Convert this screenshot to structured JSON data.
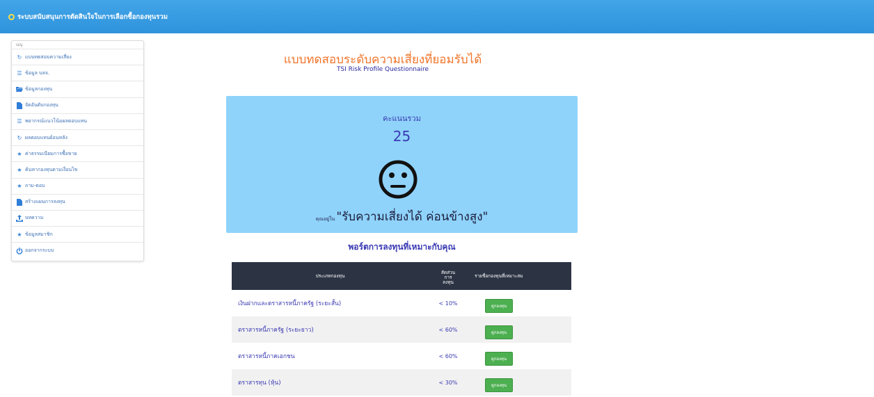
{
  "header": {
    "title": "ระบบสนับสนุนการตัดสินใจในการเลือกซื้อกองทุนรวม",
    "bg_color": "#3a9fe3"
  },
  "sidebar": {
    "caption": "เมนู",
    "items": [
      {
        "label": "แบบทดสอบความเสี่ยง",
        "icon": "refresh-icon"
      },
      {
        "label": "ข้อมูล บลจ.",
        "icon": "list-icon"
      },
      {
        "label": "ข้อมูลกองทุน",
        "icon": "folder-open-icon"
      },
      {
        "label": "จัดอันดับกองทุน",
        "icon": "file-icon"
      },
      {
        "label": "พยากรณ์แนวโน้มผลตอบแทน",
        "icon": "list-icon"
      },
      {
        "label": "ผลตอบแทนย้อนหลัง",
        "icon": "refresh-icon"
      },
      {
        "label": "ค่าธรรมเนียมการซื้อขาย",
        "icon": "star-icon"
      },
      {
        "label": "ค้นหากองทุนตามเงื่อนไข",
        "icon": "star-icon"
      },
      {
        "label": "ถาม-ตอบ",
        "icon": "star-icon"
      },
      {
        "label": "สร้างแผนการลงทุน",
        "icon": "file-icon"
      },
      {
        "label": "บทความ",
        "icon": "upload-icon"
      },
      {
        "label": "ข้อมูลสมาชิก",
        "icon": "star-icon"
      },
      {
        "label": "ออกจากระบบ",
        "icon": "power-icon"
      }
    ]
  },
  "main": {
    "title": "แบบทดสอบระดับความเสี่ยงที่ยอมรับได้",
    "subtitle": "TSI Risk Profile Questionnaire",
    "score_label": "คะแนนรวม",
    "score_value": "25",
    "face_icon": "neutral-face-icon",
    "result_prefix": "คุณอยู่ใน",
    "result_text": "\"รับความเสี่ยงได้ ค่อนข้างสูง\"",
    "panel_color": "#8fd3fb",
    "section_title": "พอร์ตการลงทุนที่เหมาะกับคุณ"
  },
  "table": {
    "headers": {
      "type": "ประเภทกองทุน",
      "ratio": [
        "สัดส่วน",
        "การ",
        "ลงทุน"
      ],
      "funds": "รายชื่อกองทุนที่เหมาะสม"
    },
    "rows": [
      {
        "type": "เงินฝากและตราสารหนี้ภาครัฐ (ระยะสั้น)",
        "ratio": "< 10%",
        "button": "ดูกองทุน"
      },
      {
        "type": "ตราสารหนี้ภาครัฐ (ระยะยาว)",
        "ratio": "< 60%",
        "button": "ดูกองทุน"
      },
      {
        "type": "ตราสารหนี้ภาคเอกชน",
        "ratio": "< 60%",
        "button": "ดูกองทุน"
      },
      {
        "type": "ตราสารทุน (หุ้น)",
        "ratio": "< 30%",
        "button": "ดูกองทุน"
      }
    ],
    "header_color": "#2c3444",
    "button_color": "#4caf50"
  }
}
